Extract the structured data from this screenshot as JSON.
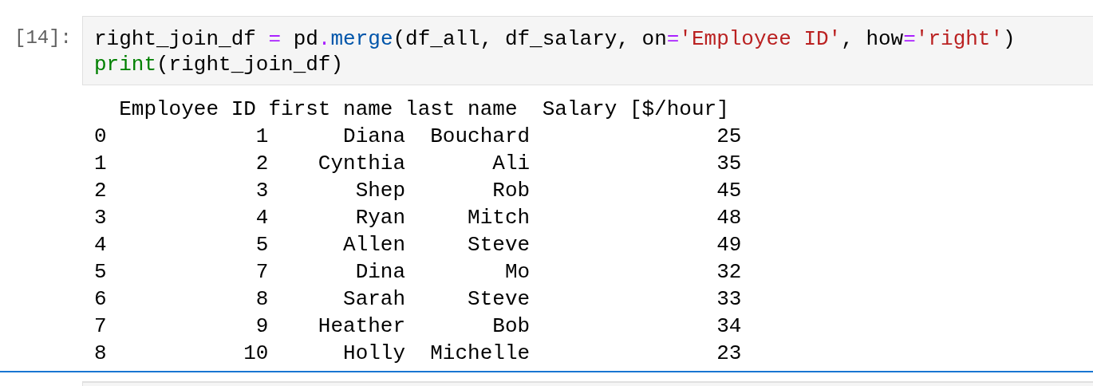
{
  "cell": {
    "prompt": "[14]:",
    "code_lines": [
      [
        {
          "kind": "name",
          "text": "right_join_df "
        },
        {
          "kind": "op",
          "text": "="
        },
        {
          "kind": "name",
          "text": " pd"
        },
        {
          "kind": "op",
          "text": "."
        },
        {
          "kind": "func",
          "text": "merge"
        },
        {
          "kind": "name",
          "text": "(df_all, df_salary, on"
        },
        {
          "kind": "op",
          "text": "="
        },
        {
          "kind": "string",
          "text": "'Employee ID'"
        },
        {
          "kind": "name",
          "text": ", how"
        },
        {
          "kind": "op",
          "text": "="
        },
        {
          "kind": "string",
          "text": "'right'"
        },
        {
          "kind": "name",
          "text": ")"
        }
      ],
      [
        {
          "kind": "builtin",
          "text": "print"
        },
        {
          "kind": "name",
          "text": "(right_join_df)"
        }
      ]
    ],
    "output_lines": [
      "  Employee ID first name last name  Salary [$/hour]",
      "0            1      Diana  Bouchard               25",
      "1            2    Cynthia       Ali               35",
      "2            3       Shep       Rob               45",
      "3            4       Ryan     Mitch               48",
      "4            5      Allen     Steve               49",
      "5            7       Dina        Mo               32",
      "6            8      Sarah     Steve               33",
      "7            9    Heather       Bob               34",
      "8           10      Holly  Michelle               23"
    ]
  }
}
